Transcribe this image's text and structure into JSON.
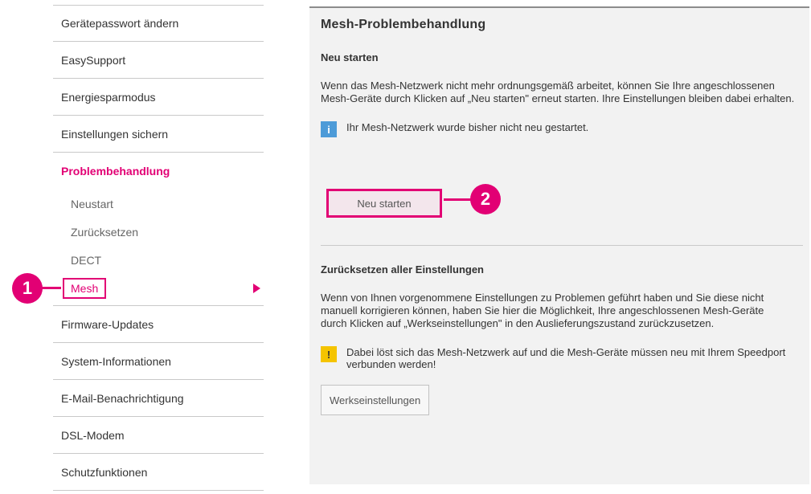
{
  "sidebar": {
    "items_before": [
      {
        "label": "Gerätepasswort ändern"
      },
      {
        "label": "EasySupport"
      },
      {
        "label": "Energiesparmodus"
      },
      {
        "label": "Einstellungen sichern"
      }
    ],
    "active_item": {
      "label": "Problembehandlung"
    },
    "sub_items": [
      {
        "label": "Neustart"
      },
      {
        "label": "Zurücksetzen"
      },
      {
        "label": "DECT"
      },
      {
        "label": "Mesh"
      }
    ],
    "items_after": [
      {
        "label": "Firmware-Updates"
      },
      {
        "label": "System-Informationen"
      },
      {
        "label": "E-Mail-Benachrichtigung"
      },
      {
        "label": "DSL-Modem"
      },
      {
        "label": "Schutzfunktionen"
      }
    ]
  },
  "main": {
    "title": "Mesh-Problembehandlung",
    "restart": {
      "heading": "Neu starten",
      "text": "Wenn das Mesh-Netzwerk nicht mehr ordnungsgemäß arbeitet, können Sie Ihre angeschlossenen Mesh-Geräte durch Klicken auf „Neu starten\" erneut starten. Ihre Einstellungen bleiben dabei erhalten.",
      "info_icon": "i",
      "info_text": "Ihr Mesh-Netzwerk wurde bisher nicht neu gestartet.",
      "button_label": "Neu starten"
    },
    "reset": {
      "heading": "Zurücksetzen aller Einstellungen",
      "text": "Wenn von Ihnen vorgenommene Einstellungen zu Problemen geführt haben und Sie diese nicht manuell korrigieren können, haben Sie hier die Möglichkeit, Ihre angeschlossenen Mesh-Geräte durch Klicken auf „Werkseinstellungen\" in den Auslieferungszustand zurückzusetzen.",
      "warn_icon": "!",
      "warn_text": "Dabei löst sich das Mesh-Netzwerk auf und die Mesh-Geräte müssen neu mit Ihrem Speedport verbunden werden!",
      "button_label": "Werkseinstellungen"
    }
  },
  "markers": {
    "marker1": "1",
    "marker2": "2"
  },
  "colors": {
    "accent": "#e20074",
    "info": "#4d9bd8",
    "warning": "#f5c400"
  }
}
